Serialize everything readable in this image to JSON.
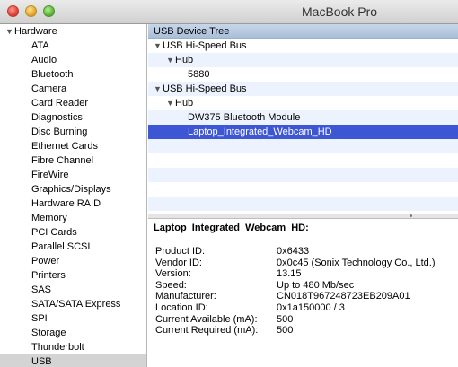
{
  "window": {
    "title": "MacBook Pro"
  },
  "sidebar": {
    "header": "Hardware",
    "items": [
      {
        "label": "ATA"
      },
      {
        "label": "Audio"
      },
      {
        "label": "Bluetooth"
      },
      {
        "label": "Camera"
      },
      {
        "label": "Card Reader"
      },
      {
        "label": "Diagnostics"
      },
      {
        "label": "Disc Burning"
      },
      {
        "label": "Ethernet Cards"
      },
      {
        "label": "Fibre Channel"
      },
      {
        "label": "FireWire"
      },
      {
        "label": "Graphics/Displays"
      },
      {
        "label": "Hardware RAID"
      },
      {
        "label": "Memory"
      },
      {
        "label": "PCI Cards"
      },
      {
        "label": "Parallel SCSI"
      },
      {
        "label": "Power"
      },
      {
        "label": "Printers"
      },
      {
        "label": "SAS"
      },
      {
        "label": "SATA/SATA Express"
      },
      {
        "label": "SPI"
      },
      {
        "label": "Storage"
      },
      {
        "label": "Thunderbolt"
      },
      {
        "label": "USB"
      }
    ],
    "selected": "USB"
  },
  "tree": {
    "header": "USB Device Tree",
    "rows": [
      {
        "label": "USB Hi-Speed Bus",
        "indent": 0,
        "expanded": true
      },
      {
        "label": "Hub",
        "indent": 1,
        "expanded": true
      },
      {
        "label": "5880",
        "indent": 2
      },
      {
        "label": "USB Hi-Speed Bus",
        "indent": 0,
        "expanded": true
      },
      {
        "label": "Hub",
        "indent": 1,
        "expanded": true
      },
      {
        "label": "DW375 Bluetooth Module",
        "indent": 2
      },
      {
        "label": "Laptop_Integrated_Webcam_HD",
        "indent": 2,
        "selected": true
      },
      {
        "label": "",
        "indent": 0
      },
      {
        "label": "",
        "indent": 0
      },
      {
        "label": "",
        "indent": 0
      },
      {
        "label": "",
        "indent": 0
      },
      {
        "label": "",
        "indent": 0
      }
    ]
  },
  "detail": {
    "title": "Laptop_Integrated_Webcam_HD:",
    "fields": [
      {
        "key": "Product ID:",
        "value": "0x6433"
      },
      {
        "key": "Vendor ID:",
        "value": "0x0c45  (Sonix Technology Co., Ltd.)"
      },
      {
        "key": "Version:",
        "value": "13.15"
      },
      {
        "key": "Speed:",
        "value": "Up to 480 Mb/sec"
      },
      {
        "key": "Manufacturer:",
        "value": "CN018T967248723EB209A01"
      },
      {
        "key": "Location ID:",
        "value": "0x1a150000 / 3"
      },
      {
        "key": "Current Available (mA):",
        "value": "500"
      },
      {
        "key": "Current Required (mA):",
        "value": "500"
      }
    ]
  }
}
